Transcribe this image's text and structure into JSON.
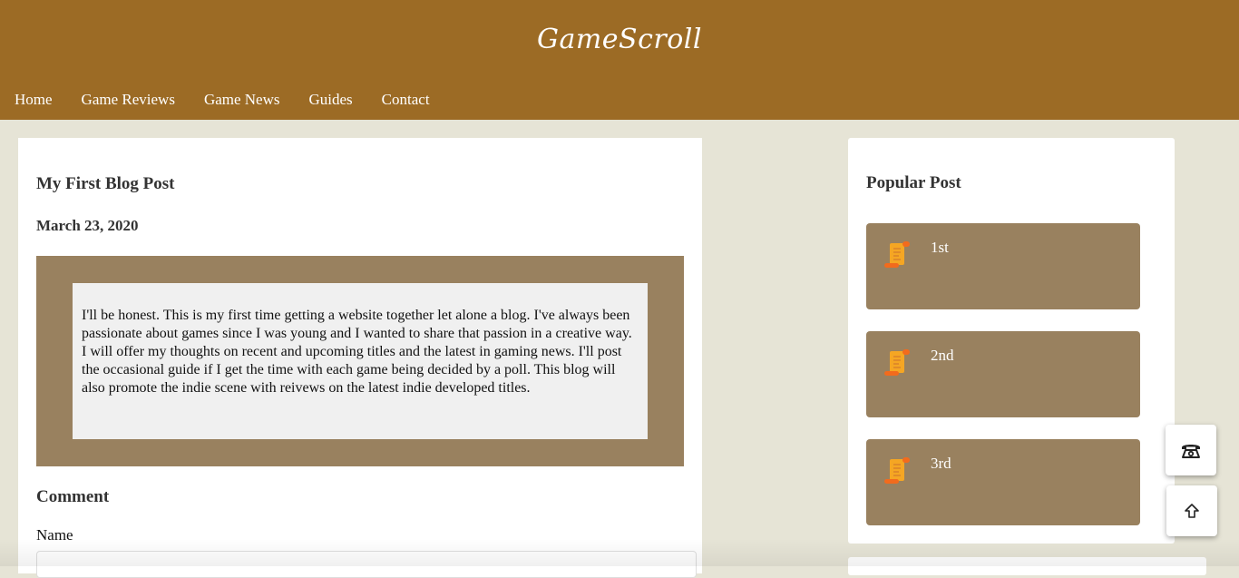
{
  "site": {
    "title": "GameScroll"
  },
  "nav": {
    "items": [
      "Home",
      "Game Reviews",
      "Game News",
      "Guides",
      "Contact"
    ]
  },
  "post": {
    "title": "My First Blog Post",
    "date": "March 23, 2020",
    "body": "I'll be honest. This is my first time getting a website together let alone a blog. I've always been passionate about games since I was young and I wanted to share that passion in a creative way. I will offer my thoughts on recent and upcoming titles and the latest in gaming news. I'll post the occasional guide if I get the time with each game being decided by a poll. This blog will also promote the indie scene with reivews on the latest indie developed titles."
  },
  "comment": {
    "heading": "Comment",
    "name_label": "Name",
    "name_value": ""
  },
  "sidebar": {
    "title": "Popular Post",
    "items": [
      {
        "label": "1st",
        "icon": "scroll-icon"
      },
      {
        "label": "2nd",
        "icon": "scroll-icon"
      },
      {
        "label": "3rd",
        "icon": "scroll-icon"
      }
    ]
  },
  "floating": {
    "contact_icon": "phone-icon",
    "top_icon": "arrow-up-icon"
  },
  "colors": {
    "header_bg": "#9c6b25",
    "page_bg": "#e6e4d6",
    "frame_bg": "#99815f",
    "post_body_bg": "#f0f0f0",
    "scroll_orange": "#f5a623"
  }
}
